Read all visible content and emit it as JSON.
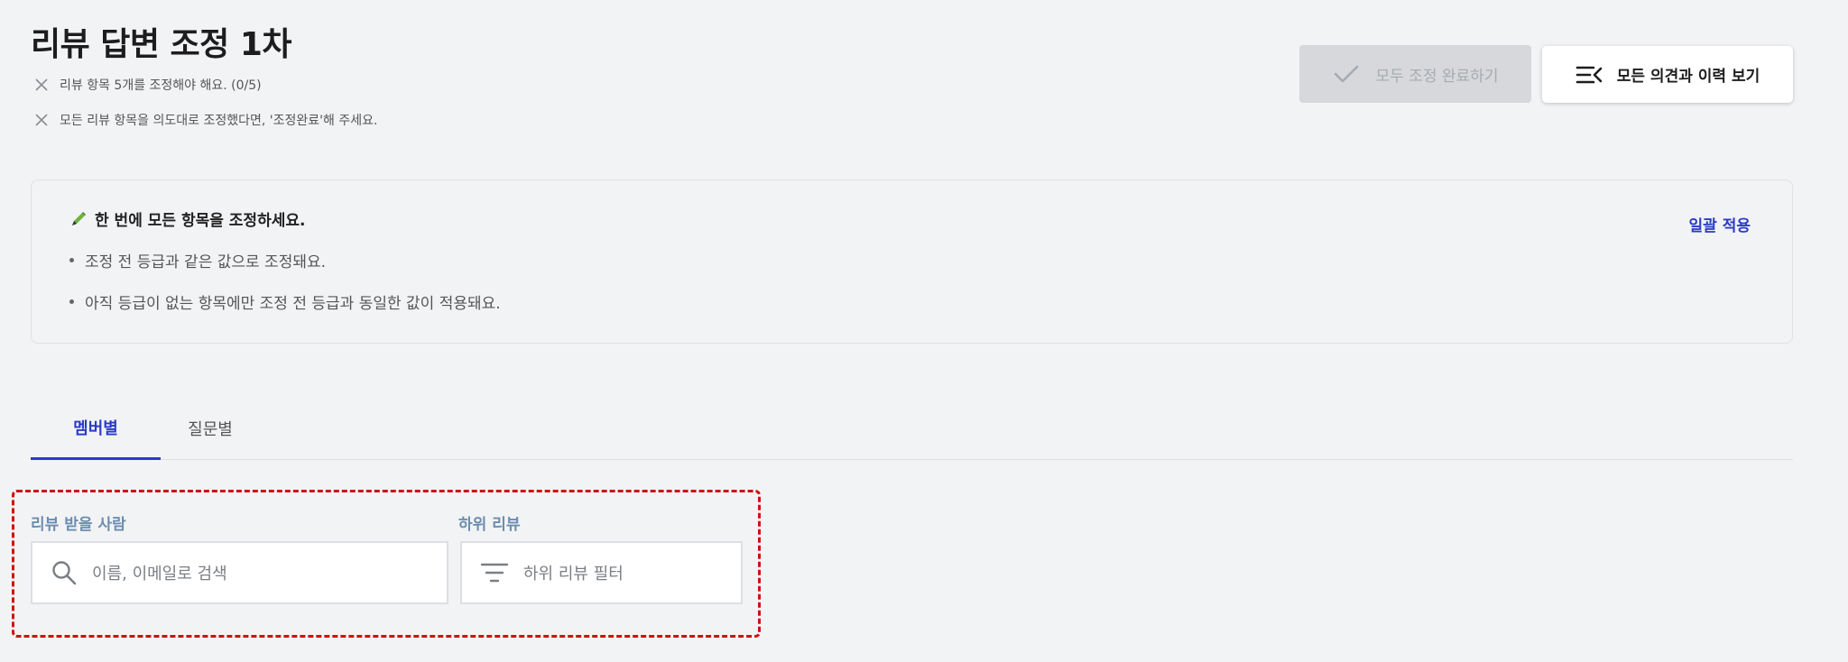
{
  "header": {
    "title": "리뷰 답변 조정 1차",
    "checks": [
      "리뷰 항목 5개를 조정해야 해요. (0/5)",
      "모든 리뷰 항목을 의도대로 조정했다면, '조정완료'해 주세요."
    ]
  },
  "actions": {
    "complete_label": "모두 조정 완료하기",
    "history_label": "모든 의견과 이력 보기"
  },
  "notice": {
    "title": "한 번에 모든 항목을 조정하세요.",
    "items": [
      "조정 전 등급과 같은 값으로 조정돼요.",
      "아직 등급이 없는 항목에만 조정 전 등급과 동일한 값이 적용돼요."
    ],
    "apply_label": "일괄 적용"
  },
  "tabs": [
    {
      "label": "멤버별",
      "active": true
    },
    {
      "label": "질문별",
      "active": false
    }
  ],
  "filters": {
    "reviewee_label": "리뷰 받을 사람",
    "search_placeholder": "이름, 이메일로 검색",
    "sub_review_label": "하위 리뷰",
    "sub_review_placeholder": "하위 리뷰 필터"
  },
  "colors": {
    "accent": "#2a3bc7",
    "highlight_border": "#d01010",
    "label": "#6c8db0"
  }
}
